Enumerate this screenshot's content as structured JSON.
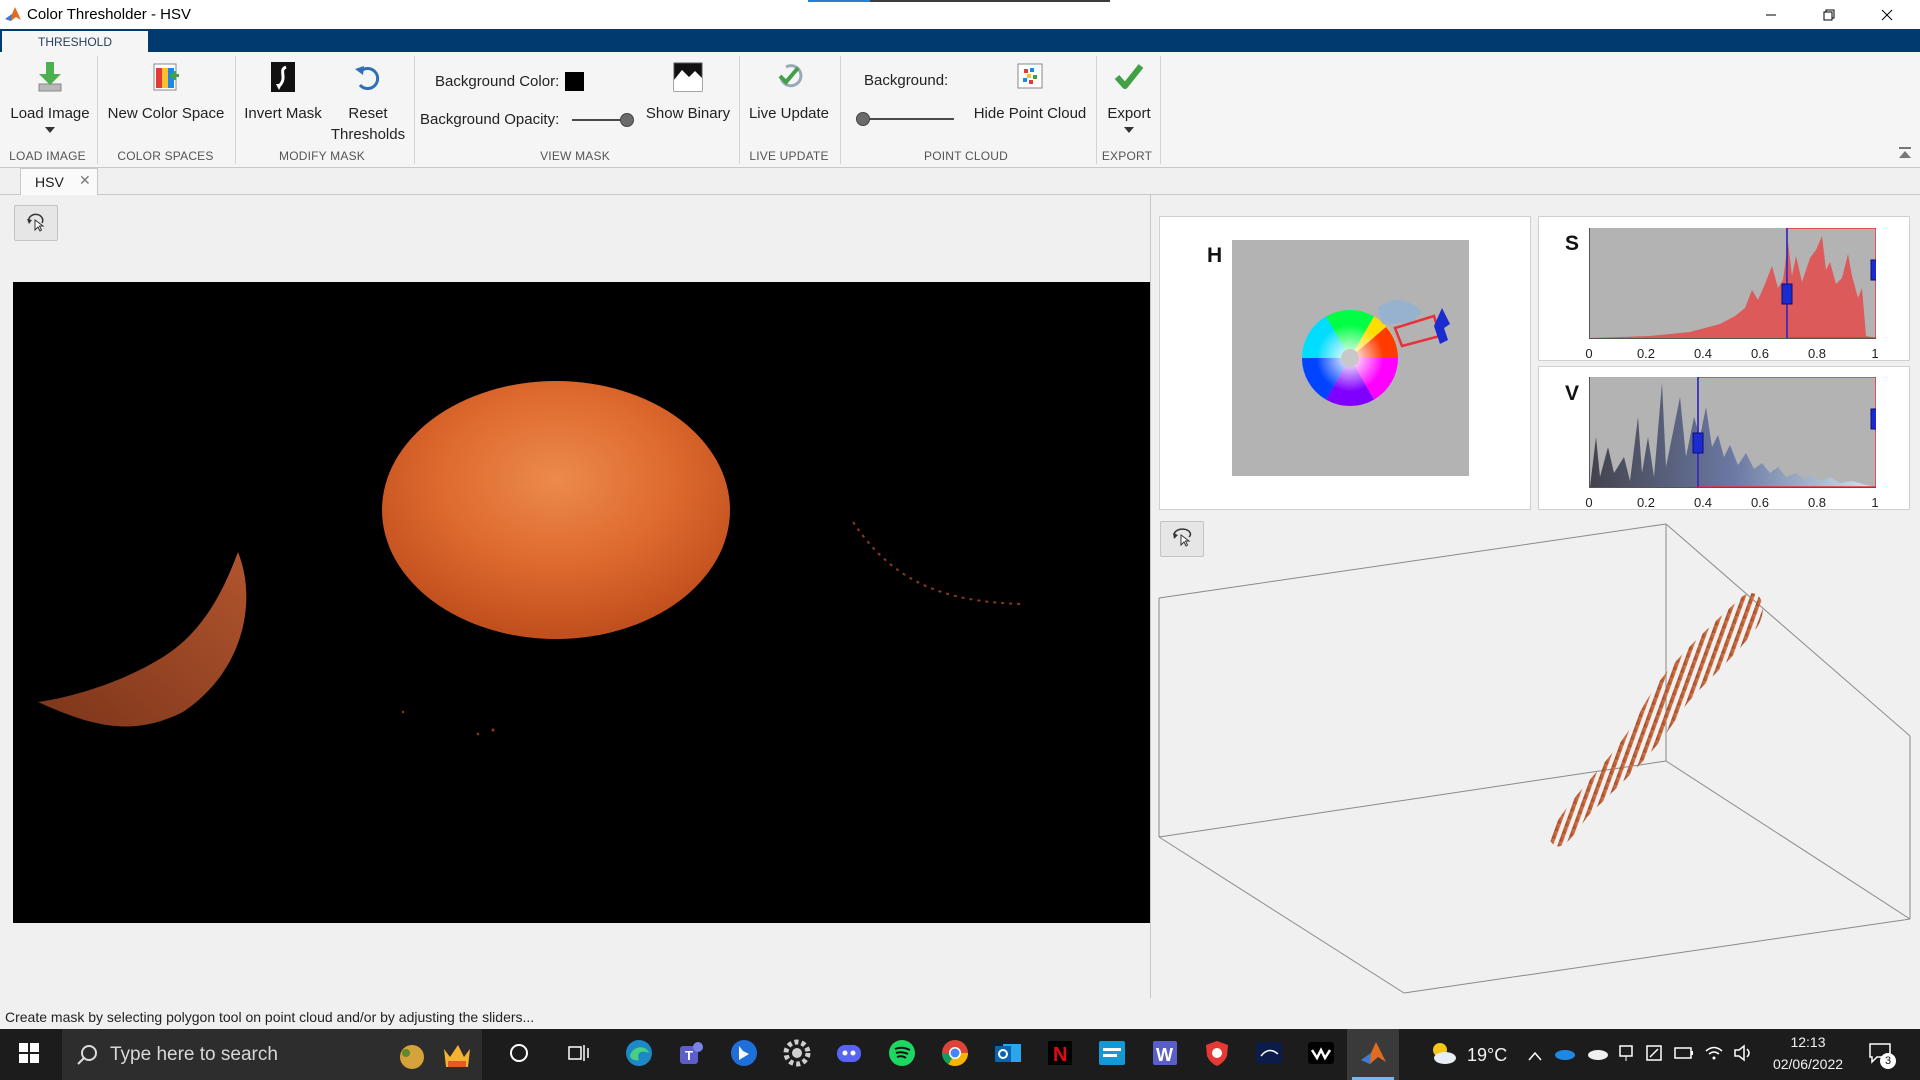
{
  "window": {
    "title": "Color Thresholder - HSV"
  },
  "ribbon": {
    "tab": "THRESHOLD",
    "buttons": {
      "load_image": "Load Image",
      "new_color_space": "New Color Space",
      "invert_mask": "Invert Mask",
      "reset_thresholds_line1": "Reset",
      "reset_thresholds_line2": "Thresholds",
      "show_binary": "Show Binary",
      "live_update": "Live Update",
      "hide_point_cloud": "Hide Point Cloud",
      "export": "Export"
    },
    "labels": {
      "background_color": "Background Color:",
      "background_opacity": "Background Opacity:",
      "background": "Background:"
    },
    "background_color_value": "#000000",
    "background_opacity_level": 1.0,
    "point_cloud_background_level": 0.0,
    "groups": {
      "load_image": "LOAD IMAGE",
      "color_spaces": "COLOR SPACES",
      "modify_mask": "MODIFY MASK",
      "view_mask": "VIEW MASK",
      "live_update": "LIVE UPDATE",
      "point_cloud": "POINT CLOUD",
      "export": "EXPORT"
    }
  },
  "document": {
    "tab": "HSV",
    "close_glyph": "✕"
  },
  "channels": {
    "h": {
      "label": "H"
    },
    "s": {
      "label": "S",
      "ticks": [
        "0",
        "0.2",
        "0.4",
        "0.6",
        "0.8",
        "1"
      ],
      "range": [
        0.69,
        1.0
      ]
    },
    "v": {
      "label": "V",
      "ticks": [
        "0",
        "0.2",
        "0.4",
        "0.6",
        "0.8",
        "1"
      ],
      "range": [
        0.38,
        1.0
      ]
    }
  },
  "status": {
    "message": "Create mask by selecting polygon tool on point cloud and/or by adjusting the sliders..."
  },
  "taskbar": {
    "search_placeholder": "Type here to search",
    "apps": [
      "edge-icon",
      "teams-icon",
      "bing-icon",
      "settings-icon",
      "discord-icon",
      "spotify-icon",
      "chrome-icon",
      "outlook-icon",
      "netflix-icon",
      "prime-video-icon",
      "word-icon",
      "vpn-icon",
      "disney-plus-icon",
      "wondershare-icon",
      "matlab-icon"
    ],
    "weather": "19°C",
    "time": "12:13",
    "date": "02/06/2022",
    "notifications": "3"
  },
  "colors": {
    "accent_blue": "#003a6f",
    "threshold_red": "#e8313a",
    "handle_blue": "#1a2bd0",
    "orange": "#d9622a"
  }
}
